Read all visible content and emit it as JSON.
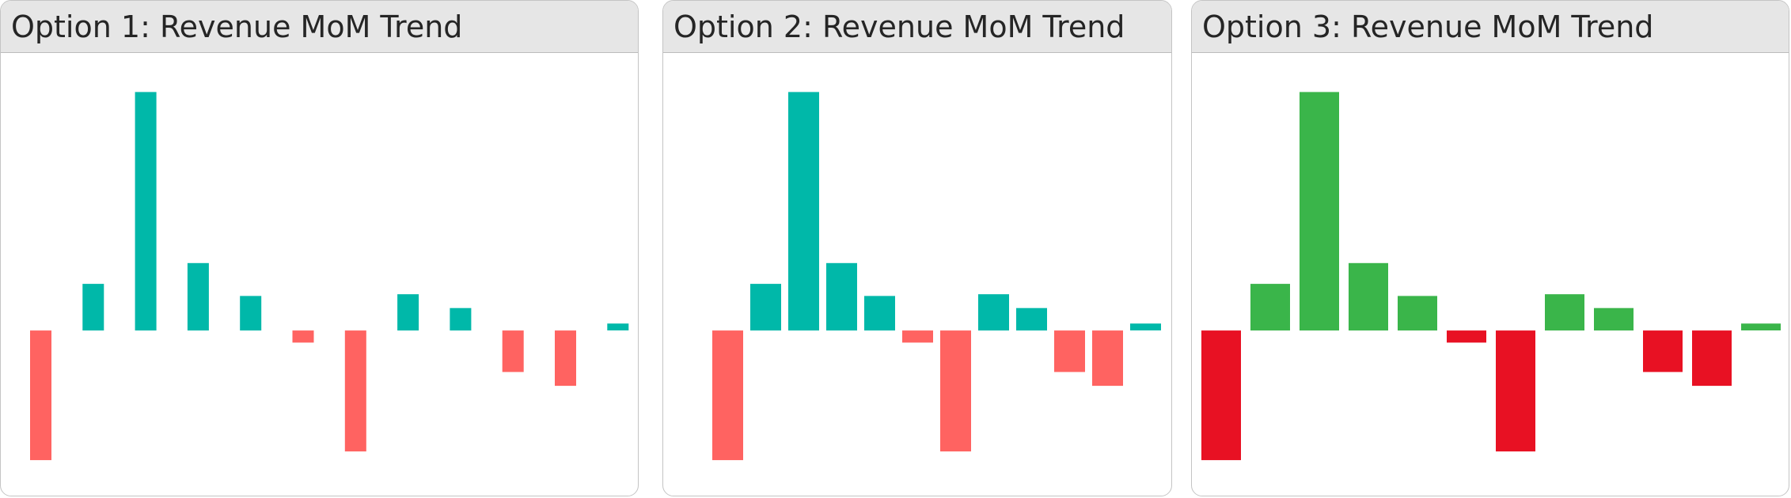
{
  "panels": [
    {
      "title": "Option 1: Revenue MoM Trend"
    },
    {
      "title": "Option 2: Revenue MoM Trend"
    },
    {
      "title": "Option 3: Revenue MoM Trend"
    }
  ],
  "chart_data": [
    {
      "type": "bar",
      "title": "Option 1: Revenue MoM Trend",
      "values": [
        -7.5,
        2.7,
        13.8,
        3.9,
        2.0,
        -0.7,
        -7.0,
        2.1,
        1.3,
        -2.4,
        -3.2,
        0.4
      ],
      "ylim": [
        -8,
        14
      ],
      "grid": false,
      "positive_color": "#00b8a9",
      "negative_color": "#ff6361"
    },
    {
      "type": "bar",
      "title": "Option 2: Revenue MoM Trend",
      "values": [
        -7.5,
        2.7,
        13.8,
        3.9,
        2.0,
        -0.7,
        -7.0,
        2.1,
        1.3,
        -2.4,
        -3.2,
        0.4
      ],
      "ylim": [
        -8,
        14
      ],
      "grid": false,
      "positive_color": "#00b8a9",
      "negative_color": "#ff6361"
    },
    {
      "type": "bar",
      "title": "Option 3: Revenue MoM Trend",
      "values": [
        -7.5,
        2.7,
        13.8,
        3.9,
        2.0,
        -0.7,
        -7.0,
        2.1,
        1.3,
        -2.4,
        -3.2,
        0.4
      ],
      "ylim": [
        -8,
        14
      ],
      "grid": false,
      "positive_color": "#3ab54a",
      "negative_color": "#e81123"
    }
  ]
}
